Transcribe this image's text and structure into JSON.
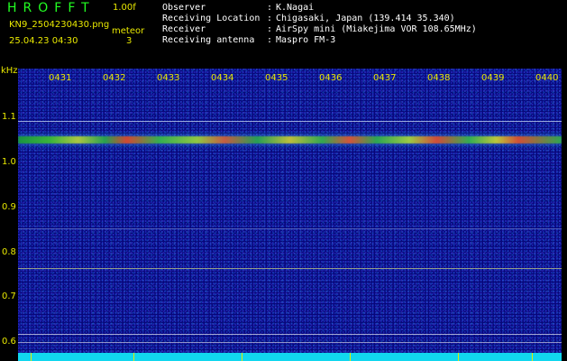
{
  "header": {
    "title": "HROFFT",
    "version": "1.00f",
    "filename": "KN9_2504230430.png",
    "mode": "meteor",
    "datetime": "25.04.23 04:30",
    "count": "3"
  },
  "info": [
    {
      "label": "Observer",
      "value": "K.Nagai"
    },
    {
      "label": "Receiving Location",
      "value": "Chigasaki, Japan (139.414 35.340)"
    },
    {
      "label": "Receiver",
      "value": "AirSpy mini (Miakejima VOR 108.65MHz)"
    },
    {
      "label": "Receiving antenna",
      "value": "Maspro FM-3"
    }
  ],
  "axis": {
    "unit": "kHz",
    "y_ticks": [
      "1.1",
      "1.0",
      "0.9",
      "0.8",
      "0.7",
      "0.6"
    ],
    "x_ticks": [
      "0431",
      "0432",
      "0433",
      "0434",
      "0435",
      "0436",
      "0437",
      "0438",
      "0439",
      "0440"
    ]
  },
  "colors": {
    "background": "#000000",
    "label_yellow": "#e8e800",
    "title_green": "#22ff22",
    "noise_blue": "#07087a",
    "floor_cyan": "#11d7ee"
  }
}
